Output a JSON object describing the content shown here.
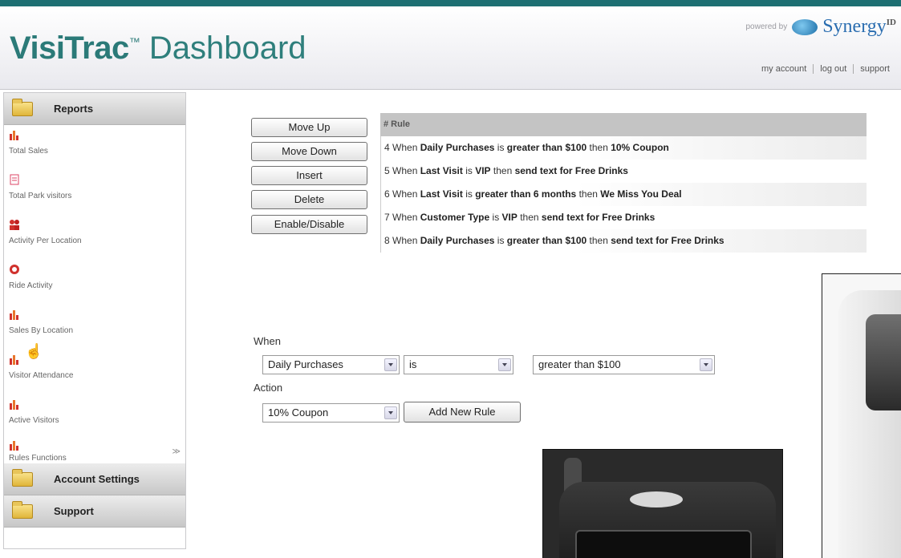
{
  "header": {
    "brand": "VisiTrac",
    "trademark": "™",
    "title_suffix": "Dashboard",
    "powered_by": "powered by",
    "partner_name": "Synergy",
    "partner_suffix": "ID",
    "links": [
      "my account",
      "log out",
      "support"
    ]
  },
  "sidebar": {
    "reports_label": "Reports",
    "account_settings_label": "Account Settings",
    "support_label": "Support",
    "items": [
      {
        "label": "Total Sales",
        "icon": "bar-chart-icon"
      },
      {
        "label": "Total Park visitors",
        "icon": "document-icon"
      },
      {
        "label": "Activity Per Location",
        "icon": "people-icon"
      },
      {
        "label": "Ride Activity",
        "icon": "circle-icon"
      },
      {
        "label": "Sales By Location",
        "icon": "bar-chart-icon"
      },
      {
        "label": "Visitor Attendance",
        "icon": "bar-chart-icon"
      },
      {
        "label": "Active Visitors",
        "icon": "bar-chart-icon"
      },
      {
        "label": "Rules Functions",
        "icon": "bar-chart-icon"
      }
    ]
  },
  "buttons": {
    "move_up": "Move Up",
    "move_down": "Move Down",
    "insert": "Insert",
    "delete": "Delete",
    "enable_disable": "Enable/Disable"
  },
  "rules": {
    "header": "# Rule",
    "rows": [
      {
        "num": "4",
        "w": "When ",
        "field": "Daily Purchases",
        "is": " is ",
        "cond": "greater than $100",
        "then": " then ",
        "action": "10% Coupon"
      },
      {
        "num": "5",
        "w": "When ",
        "field": "Last Visit",
        "is": " is ",
        "cond": "VIP",
        "then": " then ",
        "action": "send text for Free Drinks"
      },
      {
        "num": "6",
        "w": "When ",
        "field": "Last Visit",
        "is": " is ",
        "cond": "greater than 6 months",
        "then": " then ",
        "action": "We Miss You Deal"
      },
      {
        "num": "7",
        "w": "When ",
        "field": "Customer Type",
        "is": " is ",
        "cond": "VIP",
        "then": " then ",
        "action": "send text for Free Drinks"
      },
      {
        "num": "8",
        "w": "When ",
        "field": "Daily Purchases",
        "is": " is ",
        "cond": "greater than $100",
        "then": " then ",
        "action": "send text for Free Drinks"
      }
    ]
  },
  "form": {
    "when_label": "When",
    "field_value": "Daily Purchases",
    "operator_value": "is",
    "condition_value": "greater than $100",
    "action_label": "Action",
    "action_value": "10% Coupon",
    "add_button": "Add New Rule"
  },
  "colors": {
    "accent": "#2b7a78",
    "stripe": "#1d6f72",
    "report_icon_red": "#d0312d"
  }
}
